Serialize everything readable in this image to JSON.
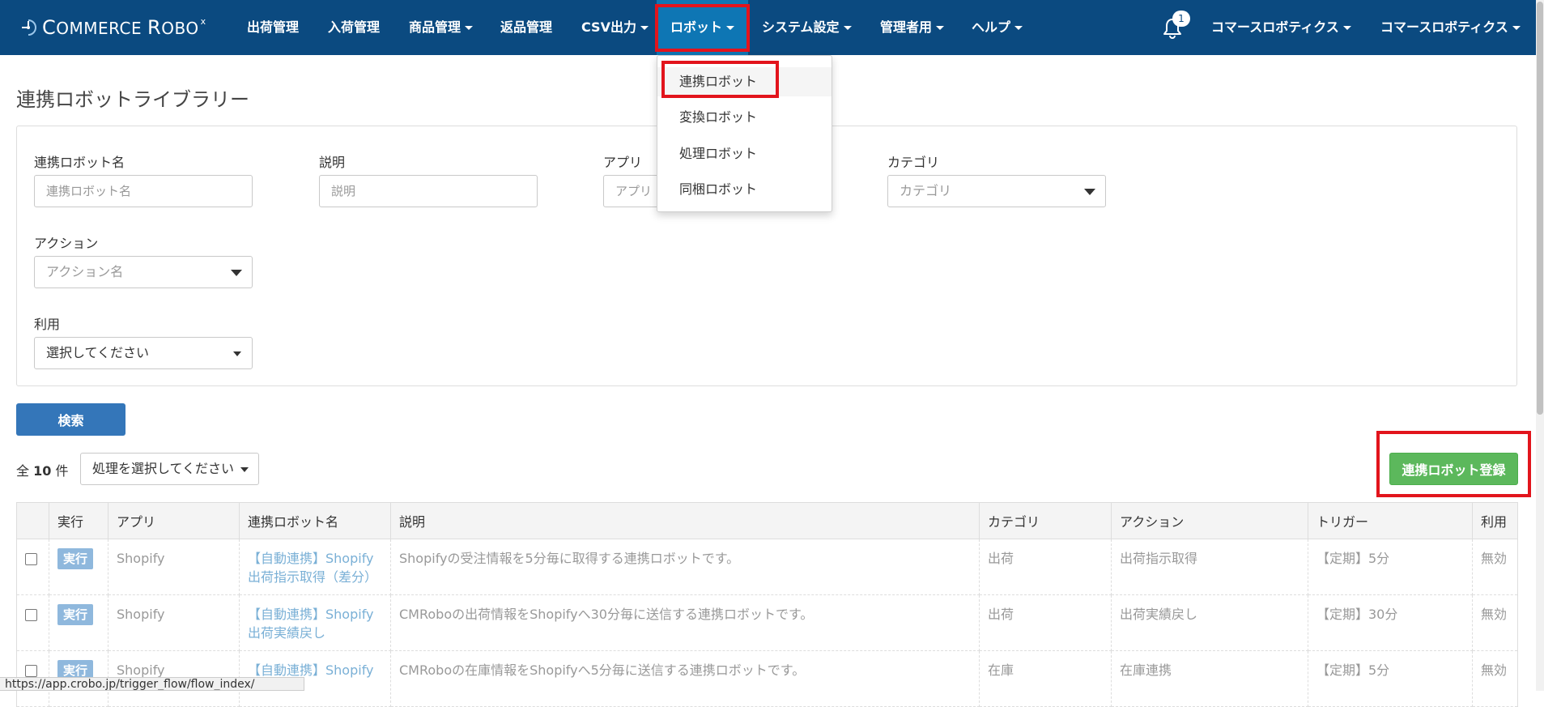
{
  "navbar": {
    "logo": {
      "first": "C",
      "first_rest": "OMMERCE",
      "second": "R",
      "second_rest": "OBO",
      "sup": "x"
    },
    "items": [
      {
        "label": "出荷管理",
        "has_caret": false
      },
      {
        "label": "入荷管理",
        "has_caret": false
      },
      {
        "label": "商品管理",
        "has_caret": true
      },
      {
        "label": "返品管理",
        "has_caret": false
      },
      {
        "label": "CSV出力",
        "has_caret": true
      },
      {
        "label": "ロボット",
        "has_caret": true,
        "active": true
      },
      {
        "label": "システム設定",
        "has_caret": true
      },
      {
        "label": "管理者用",
        "has_caret": true
      },
      {
        "label": "ヘルプ",
        "has_caret": true
      }
    ],
    "notification_count": "1",
    "user_menus": [
      {
        "label": "コマースロボティクス"
      },
      {
        "label": "コマースロボティクス"
      }
    ]
  },
  "robot_dropdown": {
    "items": [
      {
        "label": "連携ロボット"
      },
      {
        "label": "変換ロボット"
      },
      {
        "label": "処理ロボット"
      },
      {
        "label": "同梱ロボット"
      }
    ]
  },
  "page": {
    "title": "連携ロボットライブラリー"
  },
  "search_form": {
    "robot_name": {
      "label": "連携ロボット名",
      "placeholder": "連携ロボット名",
      "value": ""
    },
    "description": {
      "label": "説明",
      "placeholder": "説明",
      "value": ""
    },
    "app": {
      "label": "アプリ",
      "placeholder": "アプリ",
      "value": ""
    },
    "category": {
      "label": "カテゴリ",
      "placeholder": "カテゴリ"
    },
    "action": {
      "label": "アクション",
      "placeholder": "アクション名"
    },
    "usage": {
      "label": "利用",
      "selected": "選択してください"
    },
    "search_button": "検索"
  },
  "list_toolbar": {
    "count_prefix": "全",
    "count": "10",
    "count_suffix": "件",
    "process_select": "処理を選択してください",
    "register_button": "連携ロボット登録"
  },
  "table": {
    "headers": [
      "",
      "実行",
      "アプリ",
      "連携ロボット名",
      "説明",
      "カテゴリ",
      "アクション",
      "トリガー",
      "利用"
    ],
    "run_label": "実行",
    "rows": [
      {
        "app": "Shopify",
        "name": "【自動連携】Shopify出荷指示取得（差分）",
        "description": "Shopifyの受注情報を5分毎に取得する連携ロボットです。",
        "category": "出荷",
        "action": "出荷指示取得",
        "trigger": "【定期】5分",
        "usage": "無効"
      },
      {
        "app": "Shopify",
        "name": "【自動連携】Shopify出荷実績戻し",
        "description": "CMRoboの出荷情報をShopifyへ30分毎に送信する連携ロボットです。",
        "category": "出荷",
        "action": "出荷実績戻し",
        "trigger": "【定期】30分",
        "usage": "無効"
      },
      {
        "app": "Shopify",
        "name": "【自動連携】Shopify",
        "description": "CMRoboの在庫情報をShopifyへ5分毎に送信する連携ロボットです。",
        "category": "在庫",
        "action": "在庫連携",
        "trigger": "【定期】5分",
        "usage": "無効"
      }
    ]
  },
  "status_bar": {
    "url": "https://app.crobo.jp/trigger_flow/flow_index/"
  },
  "colors": {
    "navbar": "#0b4a80",
    "nav_active": "#0e76b4",
    "highlight_box": "#e2141c",
    "search_button": "#3476b9",
    "register_button": "#5cb85c",
    "run_button": "#8fb8dd",
    "link_text": "#7ab0d6"
  }
}
